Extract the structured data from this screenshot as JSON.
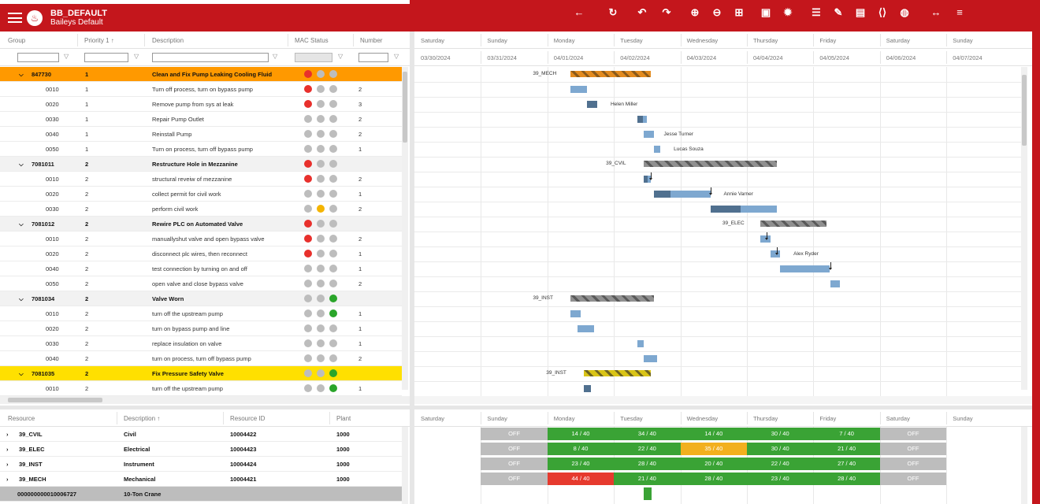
{
  "app": {
    "title": "BB_DEFAULT",
    "subtitle": "Baileys Default"
  },
  "toolbar": [
    "back-icon",
    "refresh-icon",
    "undo-icon",
    "redo-icon",
    "zoom-in-icon",
    "zoom-out-icon",
    "fit-icon",
    "print-icon",
    "settings-icon",
    "list-icon",
    "edit-icon",
    "calendar-icon",
    "code-icon",
    "globe-icon",
    "expand-icon",
    "menu-list-icon"
  ],
  "colors": {
    "brand": "#c4161c",
    "orange_row": "#ff9900",
    "yellow_row": "#ffe000",
    "header_row": "#f2f2f2",
    "cap_green": "#3aa335",
    "cap_red": "#e63a2e",
    "cap_yellow": "#f2b01e",
    "cap_off": "#bdbdbd"
  },
  "grid": {
    "columns": {
      "group": "Group",
      "priority": "Priority 1 ↑",
      "description": "Description",
      "mac": "MAC Status",
      "number": "Number"
    },
    "rows": [
      {
        "hdr": true,
        "color": "orange",
        "group": "847730",
        "priority": "1",
        "description": "Clean and Fix Pump Leaking Cooling Fluid",
        "mac": [
          "red",
          "gray",
          "gray"
        ],
        "number": ""
      },
      {
        "group": "0010",
        "priority": "1",
        "description": "Turn off process, turn on bypass pump",
        "mac": [
          "red",
          "gray",
          "gray"
        ],
        "number": "2"
      },
      {
        "group": "0020",
        "priority": "1",
        "description": "Remove pump from sys at leak",
        "mac": [
          "red",
          "gray",
          "gray"
        ],
        "number": "3"
      },
      {
        "group": "0030",
        "priority": "1",
        "description": "Repair Pump Outlet",
        "mac": [
          "gray",
          "gray",
          "gray"
        ],
        "number": "2"
      },
      {
        "group": "0040",
        "priority": "1",
        "description": "Reinstall Pump",
        "mac": [
          "gray",
          "gray",
          "gray"
        ],
        "number": "2"
      },
      {
        "group": "0050",
        "priority": "1",
        "description": "Turn on process, turn off bypass pump",
        "mac": [
          "gray",
          "gray",
          "gray"
        ],
        "number": "1"
      },
      {
        "hdr": true,
        "color": "gray",
        "group": "7081011",
        "priority": "2",
        "description": "Restructure Hole in Mezzanine",
        "mac": [
          "red",
          "gray",
          "gray"
        ],
        "number": ""
      },
      {
        "group": "0010",
        "priority": "2",
        "description": "structural reveiw of mezzanine",
        "mac": [
          "red",
          "gray",
          "gray"
        ],
        "number": "2"
      },
      {
        "group": "0020",
        "priority": "2",
        "description": "collect permit for civil work",
        "mac": [
          "gray",
          "gray",
          "gray"
        ],
        "number": "1"
      },
      {
        "group": "0030",
        "priority": "2",
        "description": "perform civil work",
        "mac": [
          "gray",
          "yellow",
          "gray"
        ],
        "number": "2"
      },
      {
        "hdr": true,
        "color": "gray",
        "group": "7081012",
        "priority": "2",
        "description": "Rewire PLC on Automated Valve",
        "mac": [
          "red",
          "gray",
          "gray"
        ],
        "number": ""
      },
      {
        "group": "0010",
        "priority": "2",
        "description": "manuallyshut valve and open bypass valve",
        "mac": [
          "red",
          "gray",
          "gray"
        ],
        "number": "2"
      },
      {
        "group": "0020",
        "priority": "2",
        "description": "disconnect plc wires, then reconnect",
        "mac": [
          "red",
          "gray",
          "gray"
        ],
        "number": "1"
      },
      {
        "group": "0040",
        "priority": "2",
        "description": "test connection by turning on and off",
        "mac": [
          "gray",
          "gray",
          "gray"
        ],
        "number": "1"
      },
      {
        "group": "0050",
        "priority": "2",
        "description": "open valve and close bypass valve",
        "mac": [
          "gray",
          "gray",
          "gray"
        ],
        "number": "2"
      },
      {
        "hdr": true,
        "color": "gray",
        "group": "7081034",
        "priority": "2",
        "description": "Valve Worn",
        "mac": [
          "gray",
          "gray",
          "green"
        ],
        "number": ""
      },
      {
        "group": "0010",
        "priority": "2",
        "description": "turn off the upstream pump",
        "mac": [
          "gray",
          "gray",
          "green"
        ],
        "number": "1"
      },
      {
        "group": "0020",
        "priority": "2",
        "description": "turn on bypass pump and line",
        "mac": [
          "gray",
          "gray",
          "gray"
        ],
        "number": "1"
      },
      {
        "group": "0030",
        "priority": "2",
        "description": "replace insulation on valve",
        "mac": [
          "gray",
          "gray",
          "gray"
        ],
        "number": "1"
      },
      {
        "group": "0040",
        "priority": "2",
        "description": "turn on process, turn off bypass pump",
        "mac": [
          "gray",
          "gray",
          "gray"
        ],
        "number": "2"
      },
      {
        "hdr": true,
        "color": "yellow",
        "group": "7081035",
        "priority": "2",
        "description": "Fix Pressure Safety Valve",
        "mac": [
          "gray",
          "gray",
          "green"
        ],
        "number": ""
      },
      {
        "group": "0010",
        "priority": "2",
        "description": "turn off the upstream pump",
        "mac": [
          "gray",
          "gray",
          "green"
        ],
        "number": "1"
      }
    ]
  },
  "gantt": {
    "days": [
      "Saturday",
      "Sunday",
      "Monday",
      "Tuesday",
      "Wednesday",
      "Thursday",
      "Friday",
      "Saturday",
      "Sunday"
    ],
    "dates": [
      "03/30/2024",
      "03/31/2024",
      "04/01/2024",
      "04/02/2024",
      "04/03/2024",
      "04/04/2024",
      "04/05/2024",
      "04/06/2024",
      "04/07/2024"
    ],
    "summary": [
      {
        "row": 0,
        "label": "39_MECH",
        "style": "orange",
        "start": 2.35,
        "end": 3.55
      },
      {
        "row": 6,
        "label": "39_CVIL",
        "style": "gray",
        "start": 3.45,
        "end": 5.45
      },
      {
        "row": 10,
        "label": "39_ELEC",
        "style": "gray",
        "start": 5.2,
        "end": 6.2
      },
      {
        "row": 15,
        "label": "39_INST",
        "style": "gray",
        "start": 2.35,
        "end": 3.6
      },
      {
        "row": 20,
        "label": "39_INST",
        "style": "yellow",
        "start": 2.55,
        "end": 3.55
      }
    ],
    "tasks": [
      {
        "row": 1,
        "start": 2.35,
        "end": 2.6,
        "prog": 0
      },
      {
        "row": 2,
        "start": 2.6,
        "end": 2.75,
        "prog": 1
      },
      {
        "row": 3,
        "start": 3.35,
        "end": 3.5,
        "prog": 0.6
      },
      {
        "row": 4,
        "start": 3.45,
        "end": 3.6,
        "prog": 0
      },
      {
        "row": 5,
        "start": 3.6,
        "end": 3.7,
        "prog": 0
      },
      {
        "row": 7,
        "start": 3.45,
        "end": 3.55,
        "prog": 0.6
      },
      {
        "row": 8,
        "start": 3.6,
        "end": 4.45,
        "prog": 0.3
      },
      {
        "row": 9,
        "start": 4.45,
        "end": 5.45,
        "prog": 0.45
      },
      {
        "row": 11,
        "start": 5.2,
        "end": 5.35,
        "prog": 0
      },
      {
        "row": 12,
        "start": 5.35,
        "end": 5.5,
        "prog": 0
      },
      {
        "row": 13,
        "start": 5.5,
        "end": 6.25,
        "prog": 0
      },
      {
        "row": 14,
        "start": 6.25,
        "end": 6.4,
        "prog": 0
      },
      {
        "row": 16,
        "start": 2.35,
        "end": 2.5,
        "prog": 0
      },
      {
        "row": 17,
        "start": 2.45,
        "end": 2.7,
        "prog": 0
      },
      {
        "row": 18,
        "start": 3.35,
        "end": 3.45,
        "prog": 0
      },
      {
        "row": 19,
        "start": 3.45,
        "end": 3.65,
        "prog": 0
      },
      {
        "row": 21,
        "start": 2.55,
        "end": 2.65,
        "prog": 1
      }
    ],
    "people": [
      {
        "row": 2,
        "name": "Helen Miller",
        "at": 2.95
      },
      {
        "row": 4,
        "name": "Jesse Turner",
        "at": 3.75
      },
      {
        "row": 5,
        "name": "Lucas Souza",
        "at": 3.9
      },
      {
        "row": 8,
        "name": "Annie Varner",
        "at": 4.65
      },
      {
        "row": 12,
        "name": "Alex Ryder",
        "at": 5.7
      }
    ],
    "links": [
      {
        "row": 7,
        "at": 3.55
      },
      {
        "row": 8,
        "at": 4.45
      },
      {
        "row": 11,
        "at": 5.3
      },
      {
        "row": 12,
        "at": 5.45
      },
      {
        "row": 13,
        "at": 6.25
      }
    ]
  },
  "resources": {
    "columns": {
      "resource": "Resource",
      "description": "Description ↑",
      "id": "Resource ID",
      "plant": "Plant"
    },
    "rows": [
      {
        "resource": "39_CVIL",
        "description": "Civil",
        "id": "10004422",
        "plant": "1000"
      },
      {
        "resource": "39_ELEC",
        "description": "Electrical",
        "id": "10004423",
        "plant": "1000"
      },
      {
        "resource": "39_INST",
        "description": "Instrument",
        "id": "10004424",
        "plant": "1000"
      },
      {
        "resource": "39_MECH",
        "description": "Mechanical",
        "id": "10004421",
        "plant": "1000"
      },
      {
        "resource": "000000000010006727",
        "description": "10-Ton Crane",
        "id": "",
        "plant": "",
        "selected": true
      }
    ]
  },
  "capacity": {
    "days": [
      "Saturday",
      "Sunday",
      "Monday",
      "Tuesday",
      "Wednesday",
      "Thursday",
      "Friday",
      "Saturday",
      "Sunday"
    ],
    "rows": [
      [
        "OFF",
        "14 / 40",
        "34 / 40",
        "14 / 40",
        "30 / 40",
        "7 / 40",
        "OFF"
      ],
      [
        "OFF",
        "8 / 40",
        "22 / 40",
        "35 / 40",
        "30 / 40",
        "21 / 40",
        "OFF"
      ],
      [
        "OFF",
        "23 / 40",
        "28 / 40",
        "20 / 40",
        "22 / 40",
        "27 / 40",
        "OFF"
      ],
      [
        "OFF",
        "44 / 40",
        "21 / 40",
        "28 / 40",
        "23 / 40",
        "28 / 40",
        "OFF"
      ]
    ],
    "status": [
      [
        "off",
        "green",
        "green",
        "green",
        "green",
        "green",
        "off"
      ],
      [
        "off",
        "green",
        "green",
        "yellow",
        "green",
        "green",
        "off"
      ],
      [
        "off",
        "green",
        "green",
        "green",
        "green",
        "green",
        "off"
      ],
      [
        "off",
        "red",
        "green",
        "green",
        "green",
        "green",
        "off"
      ]
    ]
  }
}
